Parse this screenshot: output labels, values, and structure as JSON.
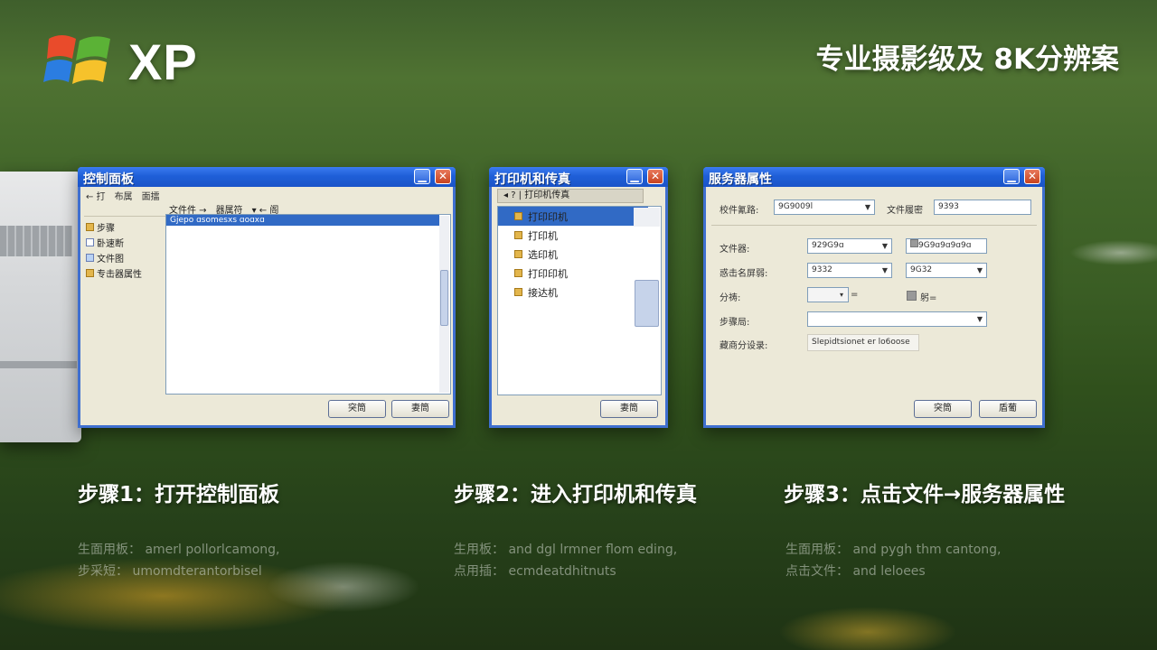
{
  "brand": {
    "logo_text": "XP",
    "tagline": "专业摄影级及 8K分辨案"
  },
  "windows": {
    "control_panel": {
      "title": "控制面板",
      "menu": [
        "← 打",
        "布属",
        "面擂"
      ],
      "toolbar": [
        "文件件 →",
        "器属符",
        "▾ ← 阁"
      ],
      "tree": [
        "步骤",
        "卧速断",
        "文件图",
        "专击器属性"
      ],
      "list_row": "Gjepo   ɑsomesxs   ɑoɑxɑ",
      "buttons": [
        "突筒",
        "妻筒"
      ]
    },
    "printers": {
      "title": "打印机和传真",
      "address": "◂ ? | 打印机传真",
      "items": [
        "打印印机",
        "打印机",
        "选印机",
        "打印印机",
        "接达机"
      ],
      "button": "妻筒"
    },
    "server_props": {
      "title": "服务器属性",
      "fields": {
        "label1": "校件氰路:",
        "value1": "9G9009l",
        "label1b": "文件履密",
        "value1b": "9393",
        "label2": "文件器:",
        "value2": "929G9ɑ",
        "value2b": "9G9ɑ9ɑ9ɑ9ɑ",
        "label3": "惑击名屏弱:",
        "value3": "9332",
        "value3b": "9G32",
        "label4": "分祷:",
        "suffix4": "=",
        "suffix4b": "躬=",
        "label5": "步骤局:",
        "value5": "",
        "label6": "藏商分设录:",
        "value6": "Slepidtsionet er lo6oose"
      },
      "buttons": [
        "突筒",
        "盾葡"
      ]
    }
  },
  "steps": [
    {
      "title": "步骤1：打开控制面板",
      "line1": "生面用板： amerl pollorlcamong,",
      "line2": "步采短： umomdterantorbisel"
    },
    {
      "title": "步骤2：进入打印机和传真",
      "line1": "生用板： and dgl lrmner flom eding,",
      "line2": "点用插： ecmdeatdhitnuts"
    },
    {
      "title": "步骤3：点击文件→服务器属性",
      "line1": "生面用板： and pygh thm cantong,",
      "line2": "点击文件： and leloees"
    }
  ]
}
